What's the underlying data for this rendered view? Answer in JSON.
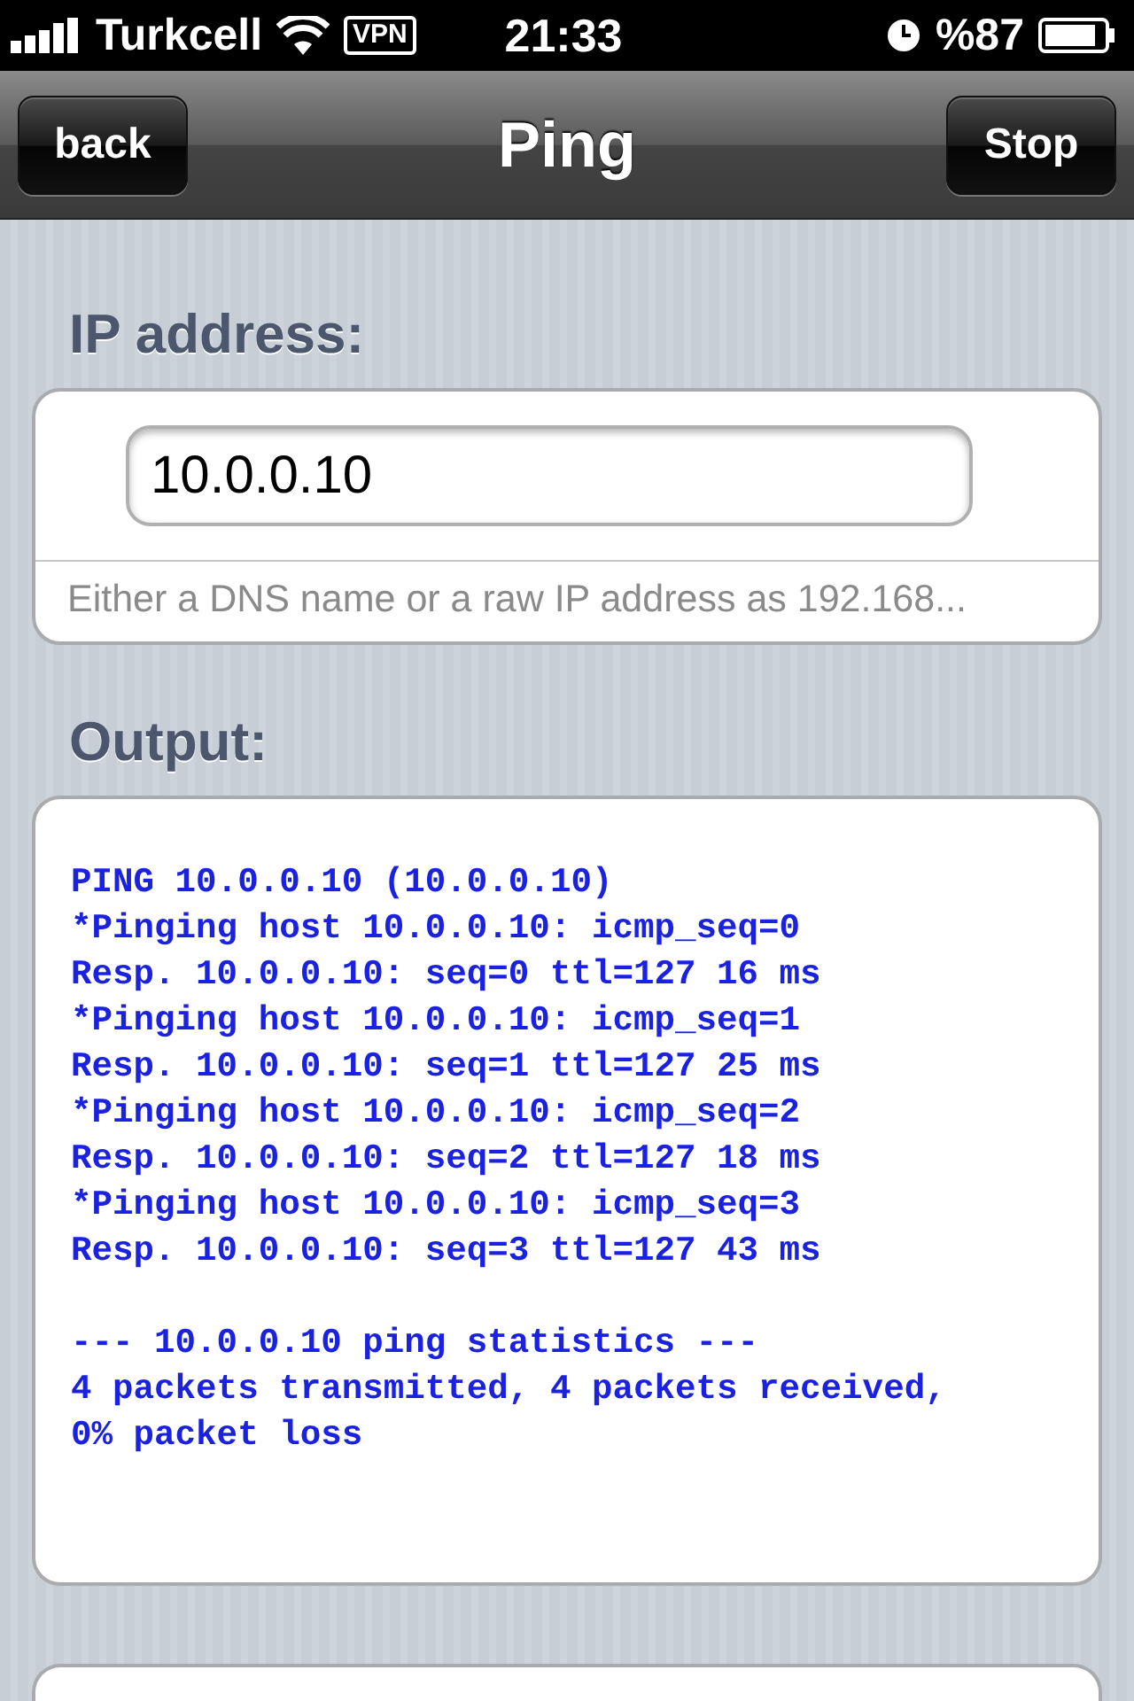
{
  "status_bar": {
    "carrier": "Turkcell",
    "vpn": "VPN",
    "time": "21:33",
    "battery": "%87"
  },
  "nav_bar": {
    "title": "Ping",
    "back_button": "back",
    "action_button": "Stop"
  },
  "ip_section": {
    "label": "IP address:",
    "value": "10.0.0.10",
    "hint": "Either a DNS name or a raw IP address as 192.168..."
  },
  "output_section": {
    "label": "Output:",
    "blocks": [
      [
        "PING 10.0.0.10 (10.0.0.10)",
        "*Pinging host 10.0.0.10: icmp_seq=0",
        "Resp. 10.0.0.10: seq=0 ttl=127 16 ms",
        "*Pinging host 10.0.0.10: icmp_seq=1",
        "Resp. 10.0.0.10: seq=1 ttl=127 25 ms",
        "*Pinging host 10.0.0.10: icmp_seq=2",
        "Resp. 10.0.0.10: seq=2 ttl=127 18 ms",
        "*Pinging host 10.0.0.10: icmp_seq=3",
        "Resp. 10.0.0.10: seq=3 ttl=127 43 ms"
      ],
      [
        "--- 10.0.0.10 ping statistics ---",
        "4 packets transmitted, 4 packets received,",
        "0% packet loss"
      ]
    ]
  }
}
